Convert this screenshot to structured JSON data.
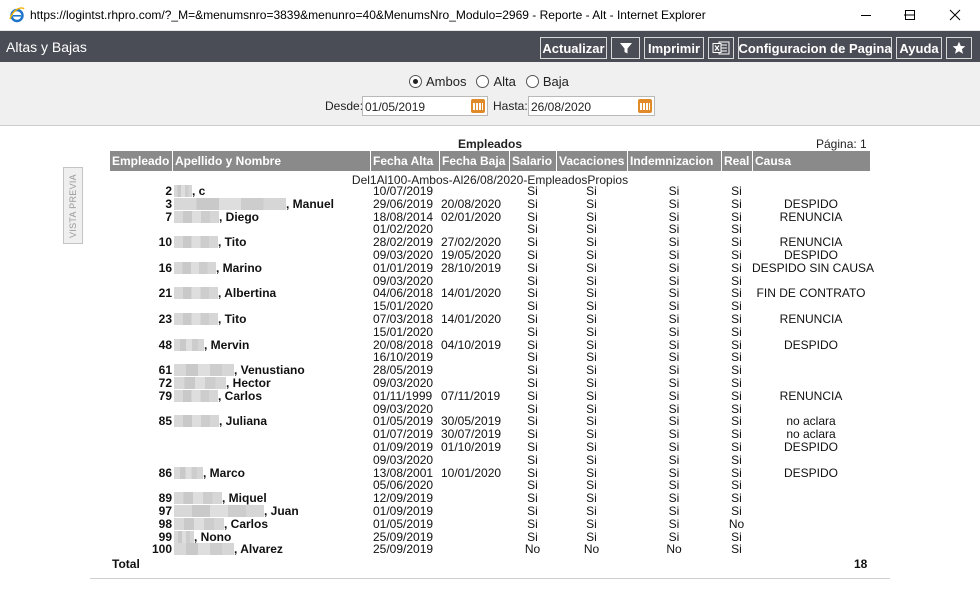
{
  "window": {
    "title": "https://logintst.rhpro.com/?_M=&menumsnro=3839&menunro=40&MenumsNro_Modulo=2969 - Reporte - Alt - Internet Explorer"
  },
  "app": {
    "title": "Altas y Bajas",
    "buttons": {
      "actualizar": "Actualizar",
      "imprimir": "Imprimir",
      "config": "Configuracion de Pagina",
      "ayuda": "Ayuda"
    }
  },
  "filters": {
    "radios": [
      {
        "label": "Ambos",
        "checked": true
      },
      {
        "label": "Alta",
        "checked": false
      },
      {
        "label": "Baja",
        "checked": false
      }
    ],
    "desde_label": "Desde:",
    "desde_value": "01/05/2019",
    "hasta_label": "Hasta:",
    "hasta_value": "26/08/2020"
  },
  "side": {
    "vista_previa": "VISTA PREVIA"
  },
  "report": {
    "title": "Empleados",
    "page_label": "Página:",
    "page_number": "1",
    "group_label": "Del1Al100-Ambos-Al26/08/2020-EmpleadosPropios",
    "columns": [
      "Empleado",
      "Apellido y Nombre",
      "Fecha Alta",
      "Fecha Baja",
      "Salario",
      "Vacaciones",
      "Indemnizacion",
      "Real",
      "Causa"
    ],
    "rows": [
      {
        "emp": "2",
        "name": ", c",
        "alta": "10/07/2019",
        "baja": "",
        "sal": "Si",
        "vac": "Si",
        "ind": "Si",
        "real": "Si",
        "causa": ""
      },
      {
        "emp": "3",
        "name": ", Manuel",
        "alta": "29/06/2019",
        "baja": "20/08/2020",
        "sal": "Si",
        "vac": "Si",
        "ind": "Si",
        "real": "Si",
        "causa": "DESPIDO"
      },
      {
        "emp": "7",
        "name": ", Diego",
        "alta": "18/08/2014",
        "baja": "02/01/2020",
        "sal": "Si",
        "vac": "Si",
        "ind": "Si",
        "real": "Si",
        "causa": "RENUNCIA"
      },
      {
        "emp": "",
        "name": "",
        "alta": "01/02/2020",
        "baja": "",
        "sal": "Si",
        "vac": "Si",
        "ind": "Si",
        "real": "Si",
        "causa": ""
      },
      {
        "emp": "10",
        "name": ", Tito",
        "alta": "28/02/2019",
        "baja": "27/02/2020",
        "sal": "Si",
        "vac": "Si",
        "ind": "Si",
        "real": "Si",
        "causa": "RENUNCIA"
      },
      {
        "emp": "",
        "name": "",
        "alta": "09/03/2020",
        "baja": "19/05/2020",
        "sal": "Si",
        "vac": "Si",
        "ind": "Si",
        "real": "Si",
        "causa": "DESPIDO"
      },
      {
        "emp": "16",
        "name": ", Marino",
        "alta": "01/01/2019",
        "baja": "28/10/2019",
        "sal": "Si",
        "vac": "Si",
        "ind": "Si",
        "real": "Si",
        "causa": "DESPIDO SIN CAUSA"
      },
      {
        "emp": "",
        "name": "",
        "alta": "09/03/2020",
        "baja": "",
        "sal": "Si",
        "vac": "Si",
        "ind": "Si",
        "real": "Si",
        "causa": ""
      },
      {
        "emp": "21",
        "name": ", Albertina",
        "alta": "04/06/2018",
        "baja": "14/01/2020",
        "sal": "Si",
        "vac": "Si",
        "ind": "Si",
        "real": "Si",
        "causa": "FIN DE CONTRATO"
      },
      {
        "emp": "",
        "name": "",
        "alta": "15/01/2020",
        "baja": "",
        "sal": "Si",
        "vac": "Si",
        "ind": "Si",
        "real": "Si",
        "causa": ""
      },
      {
        "emp": "23",
        "name": ", Tito",
        "alta": "07/03/2018",
        "baja": "14/01/2020",
        "sal": "Si",
        "vac": "Si",
        "ind": "Si",
        "real": "Si",
        "causa": "RENUNCIA"
      },
      {
        "emp": "",
        "name": "",
        "alta": "15/01/2020",
        "baja": "",
        "sal": "Si",
        "vac": "Si",
        "ind": "Si",
        "real": "Si",
        "causa": ""
      },
      {
        "emp": "48",
        "name": ", Mervin",
        "alta": "20/08/2018",
        "baja": "04/10/2019",
        "sal": "Si",
        "vac": "Si",
        "ind": "Si",
        "real": "Si",
        "causa": "DESPIDO"
      },
      {
        "emp": "",
        "name": "",
        "alta": "16/10/2019",
        "baja": "",
        "sal": "Si",
        "vac": "Si",
        "ind": "Si",
        "real": "Si",
        "causa": ""
      },
      {
        "emp": "61",
        "name": ", Venustiano",
        "alta": "28/05/2019",
        "baja": "",
        "sal": "Si",
        "vac": "Si",
        "ind": "Si",
        "real": "Si",
        "causa": ""
      },
      {
        "emp": "72",
        "name": ", Hector",
        "alta": "09/03/2020",
        "baja": "",
        "sal": "Si",
        "vac": "Si",
        "ind": "Si",
        "real": "Si",
        "causa": ""
      },
      {
        "emp": "79",
        "name": ", Carlos",
        "alta": "01/11/1999",
        "baja": "07/11/2019",
        "sal": "Si",
        "vac": "Si",
        "ind": "Si",
        "real": "Si",
        "causa": "RENUNCIA"
      },
      {
        "emp": "",
        "name": "",
        "alta": "09/03/2020",
        "baja": "",
        "sal": "Si",
        "vac": "Si",
        "ind": "Si",
        "real": "Si",
        "causa": ""
      },
      {
        "emp": "85",
        "name": ", Juliana",
        "alta": "01/05/2019",
        "baja": "30/05/2019",
        "sal": "Si",
        "vac": "Si",
        "ind": "Si",
        "real": "Si",
        "causa": "no aclara"
      },
      {
        "emp": "",
        "name": "",
        "alta": "01/07/2019",
        "baja": "30/07/2019",
        "sal": "Si",
        "vac": "Si",
        "ind": "Si",
        "real": "Si",
        "causa": "no aclara"
      },
      {
        "emp": "",
        "name": "",
        "alta": "01/09/2019",
        "baja": "01/10/2019",
        "sal": "Si",
        "vac": "Si",
        "ind": "Si",
        "real": "Si",
        "causa": "DESPIDO"
      },
      {
        "emp": "",
        "name": "",
        "alta": "09/03/2020",
        "baja": "",
        "sal": "Si",
        "vac": "Si",
        "ind": "Si",
        "real": "Si",
        "causa": ""
      },
      {
        "emp": "86",
        "name": ", Marco",
        "alta": "13/08/2001",
        "baja": "10/01/2020",
        "sal": "Si",
        "vac": "Si",
        "ind": "Si",
        "real": "Si",
        "causa": "DESPIDO"
      },
      {
        "emp": "",
        "name": "",
        "alta": "05/06/2020",
        "baja": "",
        "sal": "Si",
        "vac": "Si",
        "ind": "Si",
        "real": "Si",
        "causa": ""
      },
      {
        "emp": "89",
        "name": ", Miquel",
        "alta": "12/09/2019",
        "baja": "",
        "sal": "Si",
        "vac": "Si",
        "ind": "Si",
        "real": "Si",
        "causa": ""
      },
      {
        "emp": "97",
        "name": ", Juan",
        "alta": "01/09/2019",
        "baja": "",
        "sal": "Si",
        "vac": "Si",
        "ind": "Si",
        "real": "Si",
        "causa": ""
      },
      {
        "emp": "98",
        "name": ", Carlos",
        "alta": "01/05/2019",
        "baja": "",
        "sal": "Si",
        "vac": "Si",
        "ind": "Si",
        "real": "No",
        "causa": ""
      },
      {
        "emp": "99",
        "name": ", Nono",
        "alta": "25/09/2019",
        "baja": "",
        "sal": "Si",
        "vac": "Si",
        "ind": "Si",
        "real": "Si",
        "causa": ""
      },
      {
        "emp": "100",
        "name": ", Alvarez",
        "alta": "25/09/2019",
        "baja": "",
        "sal": "No",
        "vac": "No",
        "ind": "No",
        "real": "Si",
        "causa": ""
      }
    ],
    "total_label": "Total",
    "total_value": "18"
  }
}
